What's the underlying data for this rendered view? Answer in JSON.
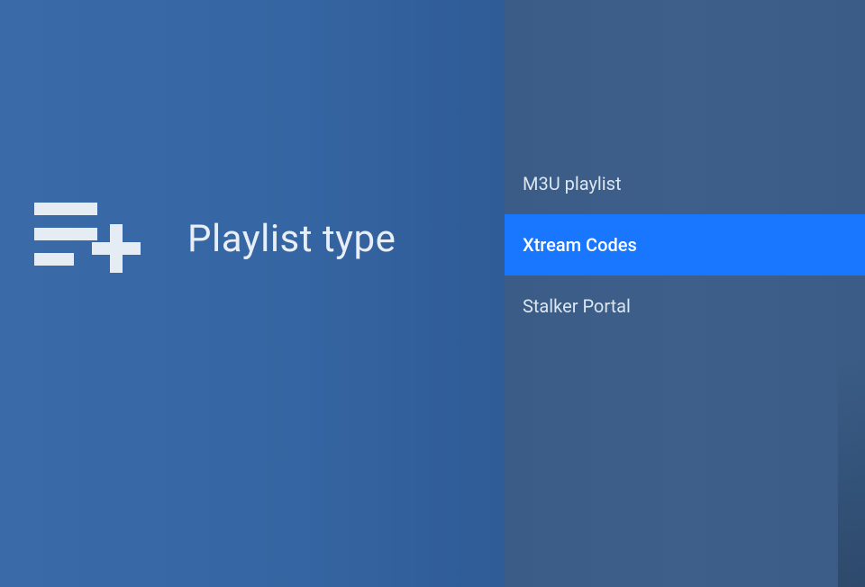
{
  "title": "Playlist type",
  "icon": "playlist-add-icon",
  "options": [
    {
      "label": "M3U playlist",
      "selected": false
    },
    {
      "label": "Xtream Codes",
      "selected": true
    },
    {
      "label": "Stalker Portal",
      "selected": false
    }
  ],
  "colors": {
    "left_bg_start": "#3a6aa8",
    "left_bg_end": "#2f5b96",
    "right_bg": "#3b5d88",
    "selected_bg": "#1976ff",
    "text": "#e8eef5"
  }
}
